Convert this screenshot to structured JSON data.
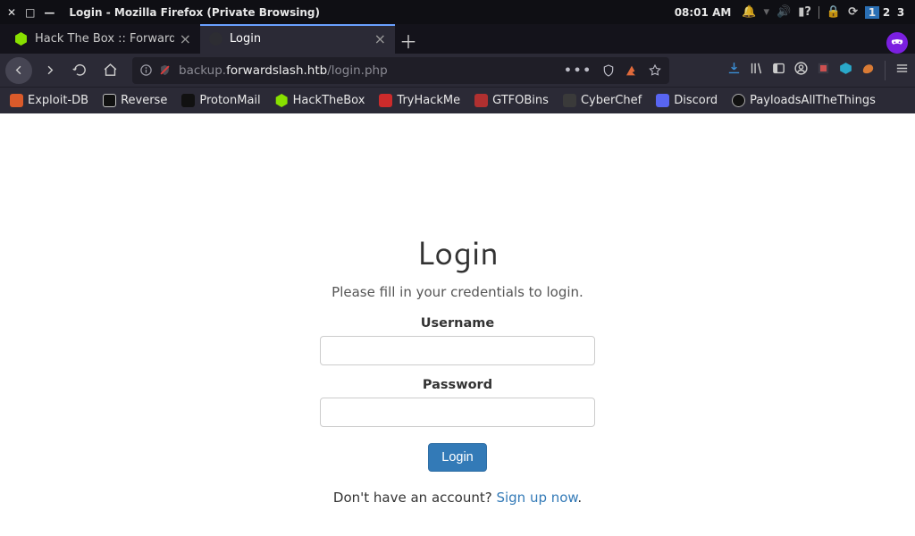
{
  "os": {
    "title": "Login - Mozilla Firefox (Private Browsing)",
    "clock": "08:01 AM",
    "workspaces": [
      "1",
      "2",
      "3"
    ]
  },
  "tabs": {
    "items": [
      {
        "label": "Hack The Box :: Forward"
      },
      {
        "label": "Login"
      }
    ]
  },
  "url": {
    "host": "backup.forwardslash.htb",
    "path": "/login.php"
  },
  "bookmarks": {
    "items": [
      {
        "label": "Exploit-DB",
        "color": "#da5a2a"
      },
      {
        "label": "Reverse",
        "color": "#bfbfbf"
      },
      {
        "label": "ProtonMail",
        "color": "#6f42c1"
      },
      {
        "label": "HackTheBox",
        "color": "#88e000"
      },
      {
        "label": "TryHackMe",
        "color": "#cc2b2b"
      },
      {
        "label": "GTFOBins",
        "color": "#b03030"
      },
      {
        "label": "CyberChef",
        "color": "#8f8f8f"
      },
      {
        "label": "Discord",
        "color": "#5865f2"
      },
      {
        "label": "PayloadsAllTheThings",
        "color": "#d0d0d0"
      }
    ]
  },
  "login": {
    "heading": "Login",
    "subheading": "Please fill in your credentials to login.",
    "username_label": "Username",
    "password_label": "Password",
    "submit": "Login",
    "signup_prompt": "Don't have an account? ",
    "signup_link": "Sign up now",
    "period": "."
  }
}
